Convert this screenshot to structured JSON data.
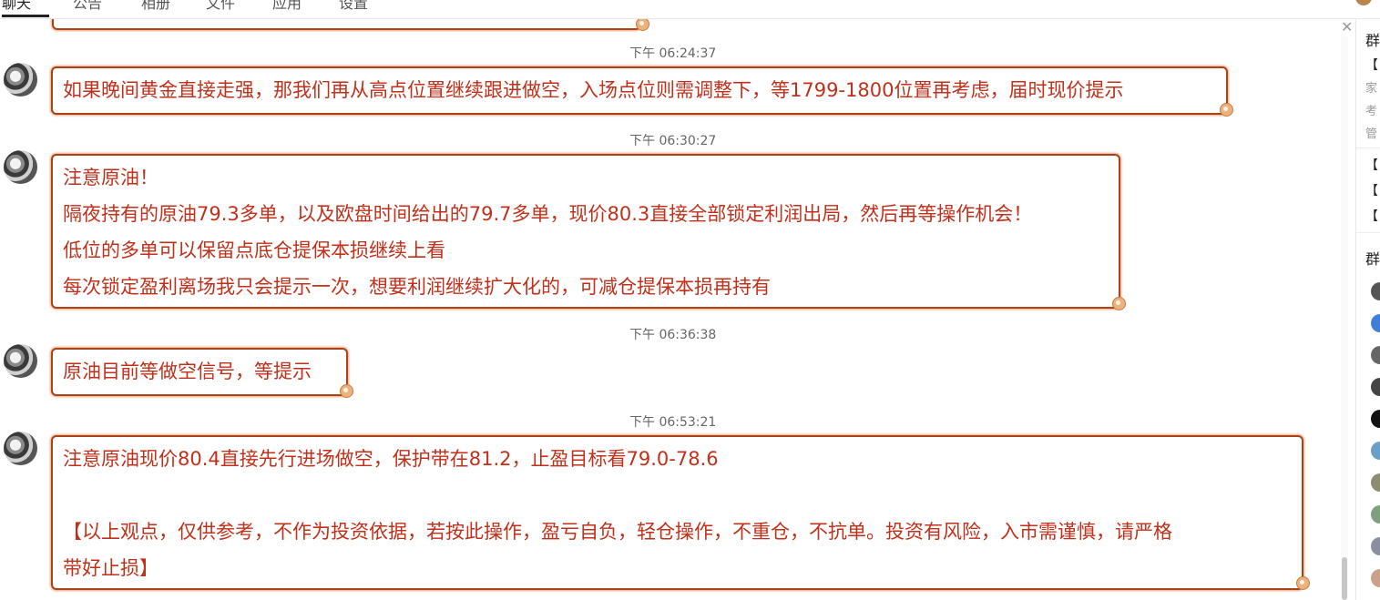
{
  "tabs": [
    "聊天",
    "公告",
    "相册",
    "文件",
    "应用",
    "设置"
  ],
  "messages": [
    {
      "time": "下午 06:24:37",
      "lines": [
        "如果晚间黄金直接走强，那我们再从高点位置继续跟进做空，入场点位则需调整下，等1799-1800位置再考虑，届时现价提示"
      ]
    },
    {
      "time": "下午 06:30:27",
      "lines": [
        "注意原油！",
        "隔夜持有的原油79.3多单，以及欧盘时间给出的79.7多单，现价80.3直接全部锁定利润出局，然后再等操作机会！",
        "低位的多单可以保留点底仓提保本损继续上看",
        "每次锁定盈利离场我只会提示一次，想要利润继续扩大化的，可减仓提保本损再持有"
      ]
    },
    {
      "time": "下午 06:36:38",
      "lines": [
        "原油目前等做空信号，等提示"
      ]
    },
    {
      "time": "下午 06:53:21",
      "lines": [
        "注意原油现价80.4直接先行进场做空，保护带在81.2，止盈目标看79.0-78.6",
        "",
        "【以上观点，仅供参考，不作为投资依据，若按此操作，盈亏自负，轻仓操作，不重仓，不抗单。投资有风险，入市需谨慎，请严格",
        "带好止损】"
      ]
    }
  ],
  "right_panel": {
    "section1_title": "群",
    "notice_lines": [
      "【",
      "家",
      "考",
      "管"
    ],
    "items": [
      "【",
      "【",
      "【"
    ],
    "section2_title": "群"
  },
  "colors": {
    "bubble_border": "#a9431b",
    "message_text": "#c0301a",
    "timestamp": "#666666"
  }
}
